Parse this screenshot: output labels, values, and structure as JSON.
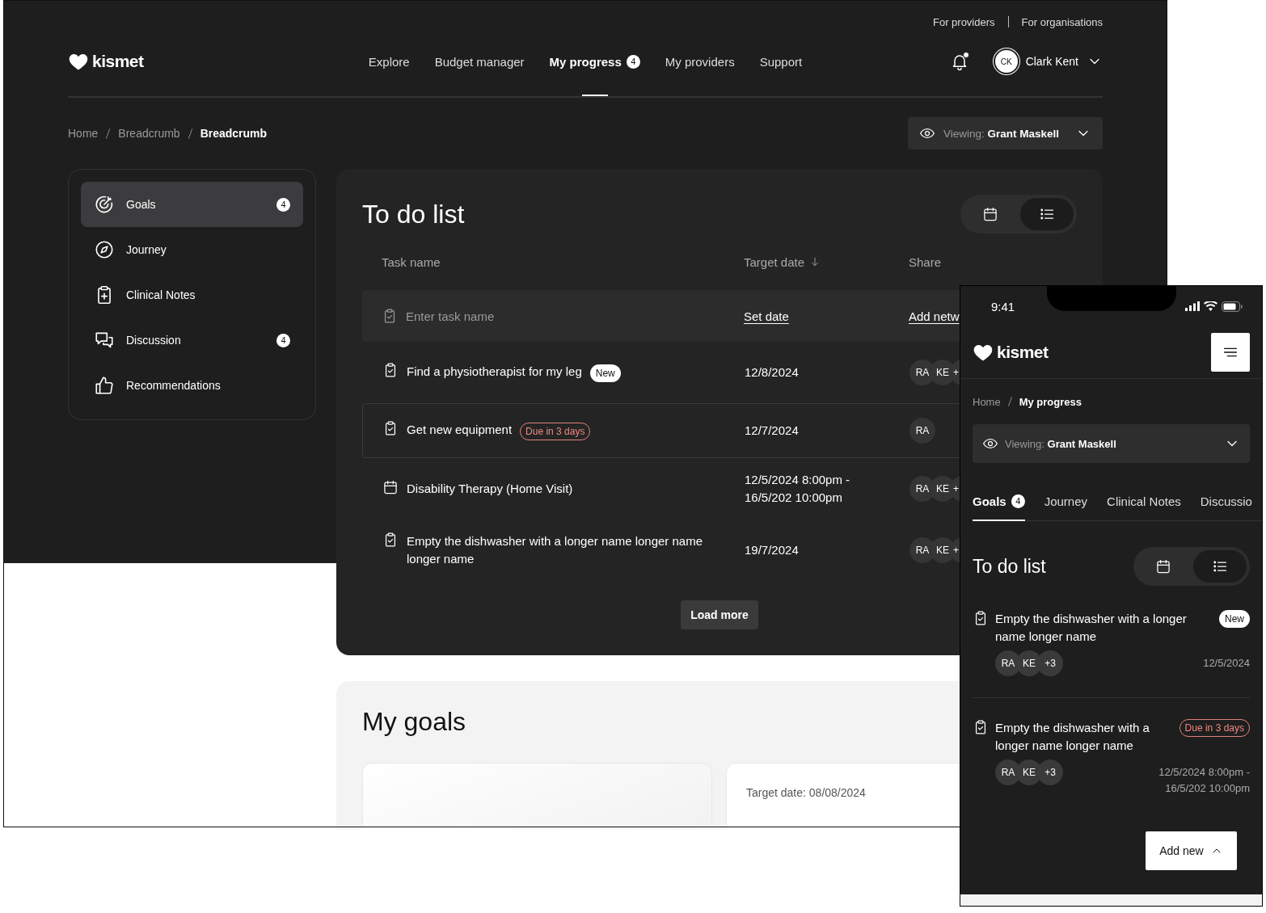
{
  "desktop": {
    "top_links": [
      "For providers",
      "For organisations"
    ],
    "logo": "kismet",
    "nav": [
      {
        "label": "Explore",
        "selected": false
      },
      {
        "label": "Budget manager",
        "selected": false
      },
      {
        "label": "My progress",
        "selected": true,
        "badge": "4"
      },
      {
        "label": "My providers",
        "selected": false
      },
      {
        "label": "Support",
        "selected": false
      }
    ],
    "notifications": {
      "unread": true
    },
    "user": {
      "initials": "CK",
      "name": "Clark Kent"
    },
    "breadcrumb": [
      "Home",
      "Breadcrumb",
      "Breadcrumb"
    ],
    "viewing": {
      "label": "Viewing:",
      "name": "Grant Maskell"
    },
    "sidebar": [
      {
        "label": "Goals",
        "selected": true,
        "badge": "4"
      },
      {
        "label": "Journey",
        "selected": false
      },
      {
        "label": "Clinical Notes",
        "selected": false
      },
      {
        "label": "Discussion",
        "selected": false,
        "badge": "4"
      },
      {
        "label": "Recommendations",
        "selected": false
      }
    ],
    "todo": {
      "title": "To do list",
      "views": [
        {
          "selected": false
        },
        {
          "selected": true
        }
      ],
      "columns": [
        {
          "label": "Task name",
          "sorted": false
        },
        {
          "label": "Target date",
          "sorted": true
        },
        {
          "label": "Share",
          "sorted": false
        }
      ],
      "new_task": {
        "placeholder": "Enter task name",
        "date_link": "Set date",
        "share_link": "Add netw"
      },
      "rows": [
        {
          "kind": "task",
          "name": "Find a physiotherapist for my leg",
          "tag": {
            "kind": "new",
            "text": "New"
          },
          "date": "12/8/2024",
          "highlighted": false,
          "share": [
            "RA",
            "KE",
            "+"
          ]
        },
        {
          "kind": "task",
          "name": "Get new equipment",
          "tag": {
            "kind": "due",
            "text": "Due in 3 days"
          },
          "date": "12/7/2024",
          "highlighted": true,
          "share": [
            "RA"
          ]
        },
        {
          "kind": "event",
          "name": "Disability Therapy (Home Visit)",
          "date": "12/5/2024 8:00pm -\n16/5/202 10:00pm",
          "highlighted": false,
          "share": [
            "RA",
            "KE",
            "+"
          ]
        },
        {
          "kind": "task",
          "name": "Empty the dishwasher with a longer name longer name longer name",
          "date": "19/7/2024",
          "highlighted": false,
          "share": [
            "RA",
            "KE",
            "+"
          ]
        }
      ],
      "load_more": "Load more"
    },
    "goals": {
      "title": "My goals",
      "cards": [
        {
          "kind": "blank"
        },
        {
          "kind": "details",
          "target_date": "Target date: 08/08/2024"
        }
      ]
    }
  },
  "mobile": {
    "time": "9:41",
    "logo": "kismet",
    "breadcrumb": [
      "Home",
      "My progress"
    ],
    "viewing": {
      "label": "Viewing:",
      "name": "Grant Maskell"
    },
    "tabs": [
      {
        "label": "Goals",
        "selected": true,
        "badge": "4"
      },
      {
        "label": "Journey",
        "selected": false
      },
      {
        "label": "Clinical Notes",
        "selected": false
      },
      {
        "label": "Discussio",
        "selected": false
      }
    ],
    "todo": {
      "title": "To do list",
      "views": [
        {
          "selected": false
        },
        {
          "selected": true
        }
      ],
      "items": [
        {
          "kind": "task",
          "name": "Empty the dishwasher with a longer name longer name",
          "tag": {
            "kind": "new",
            "text": "New"
          },
          "share": [
            "RA",
            "KE",
            "+3"
          ],
          "date": "12/5/2024"
        },
        {
          "kind": "task",
          "name": "Empty the dishwasher with a longer name longer name",
          "tag": {
            "kind": "due",
            "text": "Due in 3 days"
          },
          "share": [
            "RA",
            "KE",
            "+3"
          ],
          "date": "12/5/2024 8:00pm -\n16/5/202 10:00pm"
        }
      ]
    },
    "add_new": "Add new"
  }
}
